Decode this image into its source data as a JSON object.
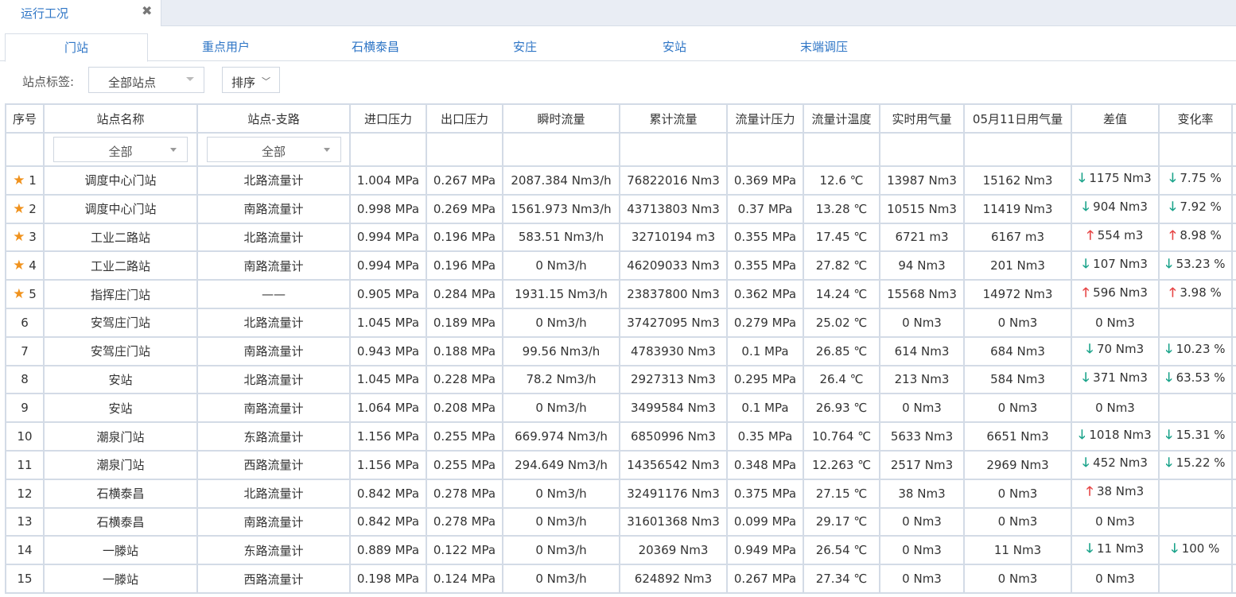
{
  "window_tab": {
    "title": "运行工况",
    "close": "✖"
  },
  "sub_tabs": [
    "门站",
    "重点用户",
    "石横泰昌",
    "安庄",
    "安站",
    "末端调压"
  ],
  "filter": {
    "label": "站点标签:",
    "station_value": "全部站点",
    "sort_label": "排序"
  },
  "table": {
    "headers": [
      "序号",
      "站点名称",
      "站点-支路",
      "进口压力",
      "出口压力",
      "瞬时流量",
      "累计流量",
      "流量计压力",
      "流量计温度",
      "实时用气量",
      "05月11日用气量",
      "差值",
      "变化率"
    ],
    "filter_values": {
      "station_name": "全部",
      "branch": "全部"
    },
    "rows": [
      {
        "no": "1",
        "star": true,
        "name": "调度中心门站",
        "branch": "北路流量计",
        "inlet": "1.004 MPa",
        "outlet": "0.267 MPa",
        "flow": "2087.384 Nm3/h",
        "total": "76822016 Nm3",
        "meter_p": "0.369 MPa",
        "meter_t": "12.6 ℃",
        "realtime": "13987 Nm3",
        "prev": "15162 Nm3",
        "diff_dir": "down",
        "diff": "1175 Nm3",
        "rate_dir": "down",
        "rate": "7.75 %"
      },
      {
        "no": "2",
        "star": true,
        "name": "调度中心门站",
        "branch": "南路流量计",
        "inlet": "0.998 MPa",
        "outlet": "0.269 MPa",
        "flow": "1561.973 Nm3/h",
        "total": "43713803 Nm3",
        "meter_p": "0.37 MPa",
        "meter_t": "13.28 ℃",
        "realtime": "10515 Nm3",
        "prev": "11419 Nm3",
        "diff_dir": "down",
        "diff": "904 Nm3",
        "rate_dir": "down",
        "rate": "7.92 %"
      },
      {
        "no": "3",
        "star": true,
        "name": "工业二路站",
        "branch": "北路流量计",
        "inlet": "0.994 MPa",
        "outlet": "0.196 MPa",
        "flow": "583.51 Nm3/h",
        "total": "32710194 m3",
        "meter_p": "0.355 MPa",
        "meter_t": "17.45 ℃",
        "realtime": "6721 m3",
        "prev": "6167 m3",
        "diff_dir": "up",
        "diff": "554 m3",
        "rate_dir": "up",
        "rate": "8.98 %"
      },
      {
        "no": "4",
        "star": true,
        "name": "工业二路站",
        "branch": "南路流量计",
        "inlet": "0.994 MPa",
        "outlet": "0.196 MPa",
        "flow": "0 Nm3/h",
        "total": "46209033 Nm3",
        "meter_p": "0.355 MPa",
        "meter_t": "27.82 ℃",
        "realtime": "94 Nm3",
        "prev": "201 Nm3",
        "diff_dir": "down",
        "diff": "107 Nm3",
        "rate_dir": "down",
        "rate": "53.23 %"
      },
      {
        "no": "5",
        "star": true,
        "name": "指挥庄门站",
        "branch": "——",
        "inlet": "0.905 MPa",
        "outlet": "0.284 MPa",
        "flow": "1931.15 Nm3/h",
        "total": "23837800 Nm3",
        "meter_p": "0.362 MPa",
        "meter_t": "14.24 ℃",
        "realtime": "15568 Nm3",
        "prev": "14972 Nm3",
        "diff_dir": "up",
        "diff": "596 Nm3",
        "rate_dir": "up",
        "rate": "3.98 %"
      },
      {
        "no": "6",
        "star": false,
        "name": "安驾庄门站",
        "branch": "北路流量计",
        "inlet": "1.045 MPa",
        "outlet": "0.189 MPa",
        "flow": "0 Nm3/h",
        "total": "37427095 Nm3",
        "meter_p": "0.279 MPa",
        "meter_t": "25.02 ℃",
        "realtime": "0 Nm3",
        "prev": "0 Nm3",
        "diff_dir": "",
        "diff": "0 Nm3",
        "rate_dir": "",
        "rate": ""
      },
      {
        "no": "7",
        "star": false,
        "name": "安驾庄门站",
        "branch": "南路流量计",
        "inlet": "0.943 MPa",
        "outlet": "0.188 MPa",
        "flow": "99.56 Nm3/h",
        "total": "4783930 Nm3",
        "meter_p": "0.1 MPa",
        "meter_t": "26.85 ℃",
        "realtime": "614 Nm3",
        "prev": "684 Nm3",
        "diff_dir": "down",
        "diff": "70 Nm3",
        "rate_dir": "down",
        "rate": "10.23 %"
      },
      {
        "no": "8",
        "star": false,
        "name": "安站",
        "branch": "北路流量计",
        "inlet": "1.045 MPa",
        "outlet": "0.228 MPa",
        "flow": "78.2 Nm3/h",
        "total": "2927313 Nm3",
        "meter_p": "0.295 MPa",
        "meter_t": "26.4 ℃",
        "realtime": "213 Nm3",
        "prev": "584 Nm3",
        "diff_dir": "down",
        "diff": "371 Nm3",
        "rate_dir": "down",
        "rate": "63.53 %"
      },
      {
        "no": "9",
        "star": false,
        "name": "安站",
        "branch": "南路流量计",
        "inlet": "1.064 MPa",
        "outlet": "0.208 MPa",
        "flow": "0 Nm3/h",
        "total": "3499584 Nm3",
        "meter_p": "0.1 MPa",
        "meter_t": "26.93 ℃",
        "realtime": "0 Nm3",
        "prev": "0 Nm3",
        "diff_dir": "",
        "diff": "0 Nm3",
        "rate_dir": "",
        "rate": ""
      },
      {
        "no": "10",
        "star": false,
        "name": "潮泉门站",
        "branch": "东路流量计",
        "inlet": "1.156 MPa",
        "outlet": "0.255 MPa",
        "flow": "669.974 Nm3/h",
        "total": "6850996 Nm3",
        "meter_p": "0.35 MPa",
        "meter_t": "10.764 ℃",
        "realtime": "5633 Nm3",
        "prev": "6651 Nm3",
        "diff_dir": "down",
        "diff": "1018 Nm3",
        "rate_dir": "down",
        "rate": "15.31 %"
      },
      {
        "no": "11",
        "star": false,
        "name": "潮泉门站",
        "branch": "西路流量计",
        "inlet": "1.156 MPa",
        "outlet": "0.255 MPa",
        "flow": "294.649 Nm3/h",
        "total": "14356542 Nm3",
        "meter_p": "0.348 MPa",
        "meter_t": "12.263 ℃",
        "realtime": "2517 Nm3",
        "prev": "2969 Nm3",
        "diff_dir": "down",
        "diff": "452 Nm3",
        "rate_dir": "down",
        "rate": "15.22 %"
      },
      {
        "no": "12",
        "star": false,
        "name": "石横泰昌",
        "branch": "北路流量计",
        "inlet": "0.842 MPa",
        "outlet": "0.278 MPa",
        "flow": "0 Nm3/h",
        "total": "32491176 Nm3",
        "meter_p": "0.375 MPa",
        "meter_t": "27.15 ℃",
        "realtime": "38 Nm3",
        "prev": "0 Nm3",
        "diff_dir": "up",
        "diff": "38 Nm3",
        "rate_dir": "",
        "rate": ""
      },
      {
        "no": "13",
        "star": false,
        "name": "石横泰昌",
        "branch": "南路流量计",
        "inlet": "0.842 MPa",
        "outlet": "0.278 MPa",
        "flow": "0 Nm3/h",
        "total": "31601368 Nm3",
        "meter_p": "0.099 MPa",
        "meter_t": "29.17 ℃",
        "realtime": "0 Nm3",
        "prev": "0 Nm3",
        "diff_dir": "",
        "diff": "0 Nm3",
        "rate_dir": "",
        "rate": ""
      },
      {
        "no": "14",
        "star": false,
        "name": "一滕站",
        "branch": "东路流量计",
        "inlet": "0.889 MPa",
        "outlet": "0.122 MPa",
        "flow": "0 Nm3/h",
        "total": "20369 Nm3",
        "meter_p": "0.949 MPa",
        "meter_t": "26.54 ℃",
        "realtime": "0 Nm3",
        "prev": "11 Nm3",
        "diff_dir": "down",
        "diff": "11 Nm3",
        "rate_dir": "down",
        "rate": "100 %"
      },
      {
        "no": "15",
        "star": false,
        "name": "一滕站",
        "branch": "西路流量计",
        "inlet": "0.198 MPa",
        "outlet": "0.124 MPa",
        "flow": "0 Nm3/h",
        "total": "624892 Nm3",
        "meter_p": "0.267 MPa",
        "meter_t": "27.34 ℃",
        "realtime": "0 Nm3",
        "prev": "0 Nm3",
        "diff_dir": "",
        "diff": "0 Nm3",
        "rate_dir": "",
        "rate": ""
      }
    ]
  },
  "icons": {
    "star": "★",
    "arrow_down": "🡓",
    "arrow_up": "🡑"
  },
  "colors": {
    "accent": "#2f76c6",
    "star": "#f0921d",
    "down": "#1aa38a",
    "up": "#e64545",
    "grid": "#d3dbe6"
  }
}
